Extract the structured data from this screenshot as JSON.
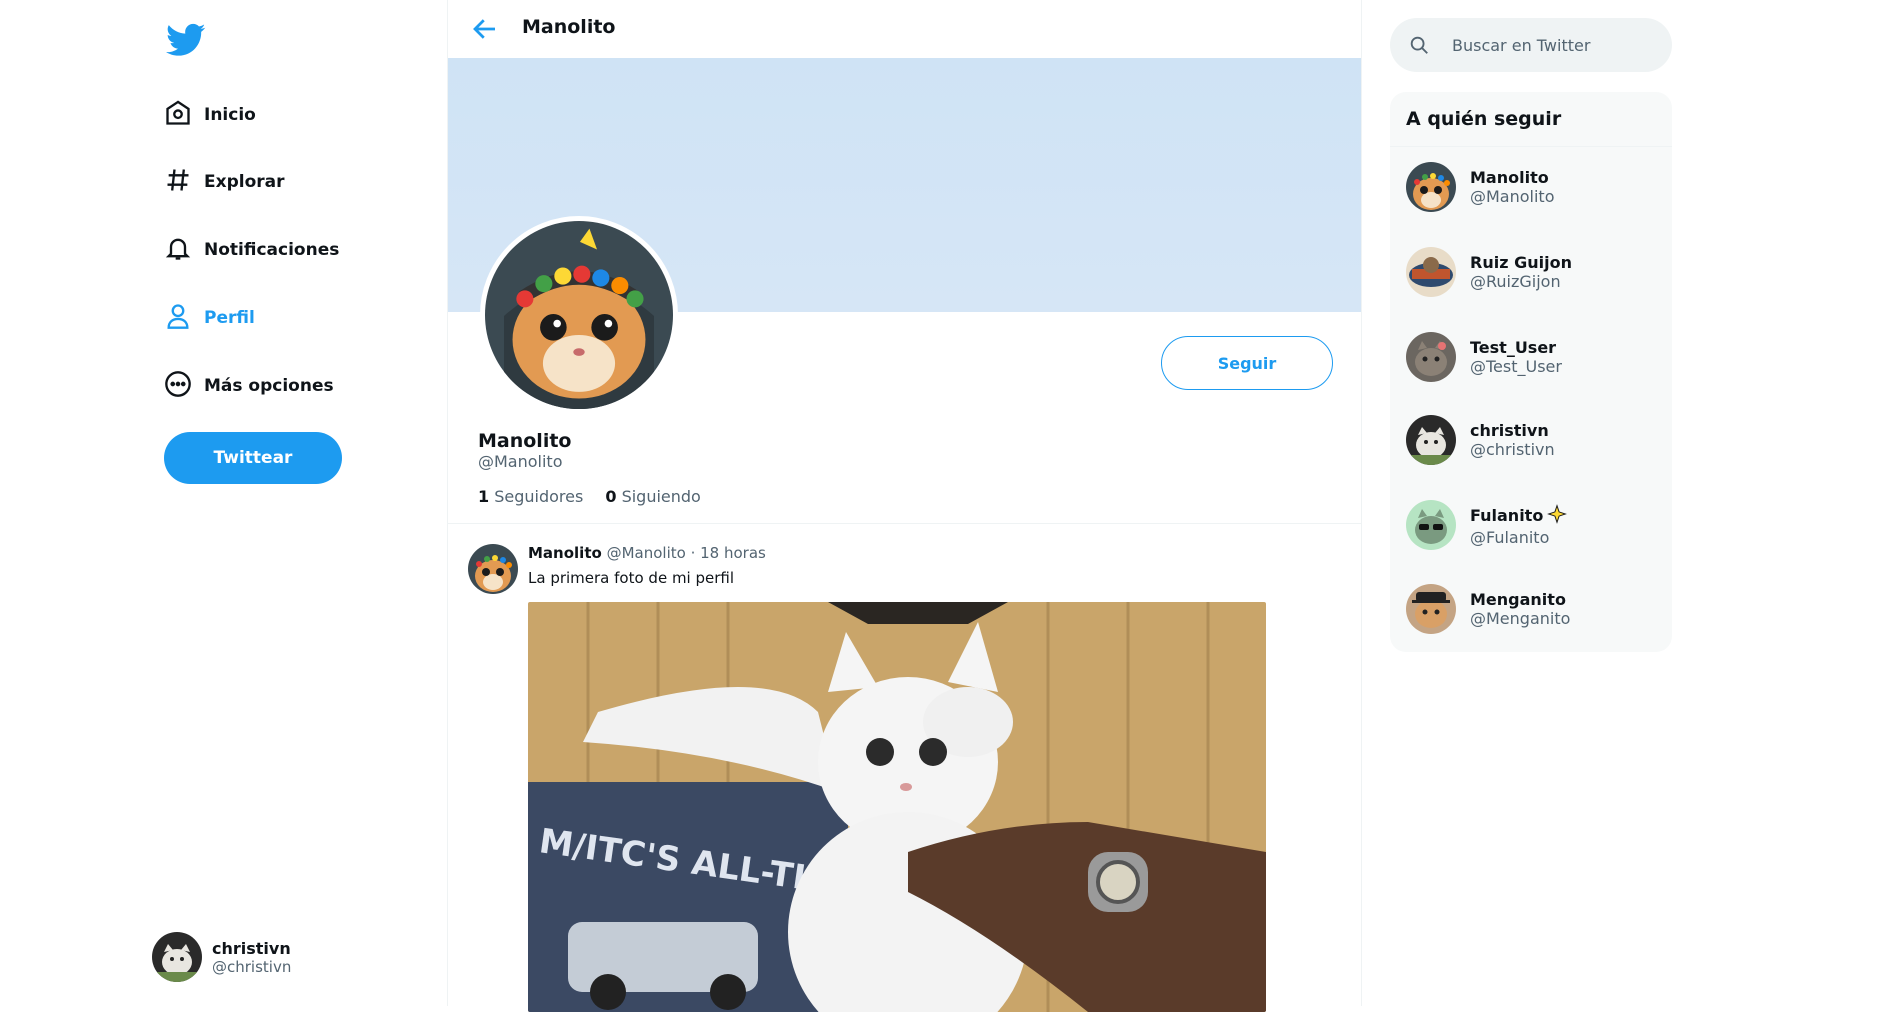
{
  "sidebar": {
    "items": [
      {
        "label": "Inicio",
        "icon": "home-icon"
      },
      {
        "label": "Explorar",
        "icon": "hashtag-icon"
      },
      {
        "label": "Notificaciones",
        "icon": "bell-icon"
      },
      {
        "label": "Perfil",
        "icon": "user-icon"
      },
      {
        "label": "Más opciones",
        "icon": "more-circle-icon"
      }
    ],
    "tweet_button": "Twittear",
    "account": {
      "name": "christivn",
      "handle": "@christivn"
    }
  },
  "profile": {
    "header_title": "Manolito",
    "name": "Manolito",
    "handle": "@Manolito",
    "follow_button": "Seguir",
    "followers_count": "1",
    "followers_label": "Seguidores",
    "following_count": "0",
    "following_label": "Siguiendo"
  },
  "tweet": {
    "author": "Manolito",
    "handle": "@Manolito",
    "time": "· 18 horas",
    "text": "La primera foto de mi perfil",
    "media_caption": "M/ITC'S ALL-TIME TOP TEAM"
  },
  "search": {
    "placeholder": "Buscar en Twitter"
  },
  "who_to_follow": {
    "title": "A quién seguir",
    "users": [
      {
        "name": "Manolito",
        "handle": "@Manolito"
      },
      {
        "name": "Ruiz Guijon",
        "handle": "@RuizGijon"
      },
      {
        "name": "Test_User",
        "handle": "@Test_User"
      },
      {
        "name": "christivn",
        "handle": "@christivn"
      },
      {
        "name": "Fulanito",
        "handle": "@Fulanito",
        "badge": "sparkle-icon"
      },
      {
        "name": "Menganito",
        "handle": "@Menganito"
      }
    ]
  },
  "colors": {
    "accent": "#1d9bf0",
    "banner": "#d0e4f5",
    "text": "#0f1419",
    "muted": "#536471"
  }
}
